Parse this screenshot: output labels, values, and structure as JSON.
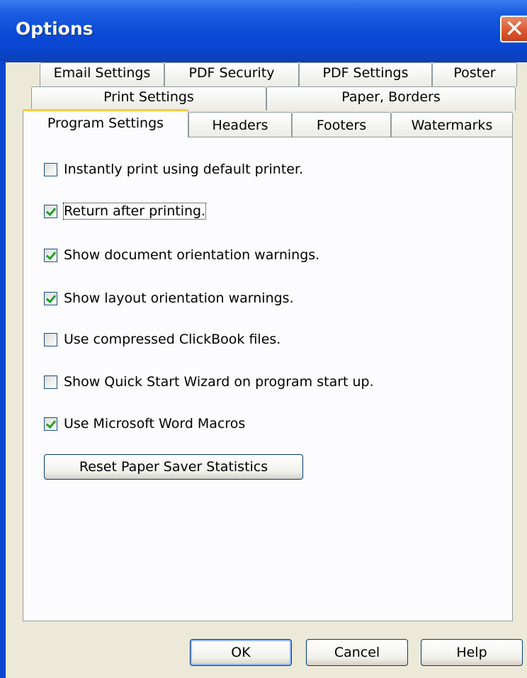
{
  "window": {
    "title": "Options"
  },
  "tabs": {
    "row1": [
      "Email Settings",
      "PDF Security",
      "PDF Settings",
      "Poster"
    ],
    "row2": [
      "Print Settings",
      "Paper, Borders"
    ],
    "row3": [
      "Program Settings",
      "Headers",
      "Footers",
      "Watermarks"
    ],
    "active": "Program Settings"
  },
  "options": [
    {
      "label": "Instantly print using default printer.",
      "checked": false
    },
    {
      "label": "Return after printing.",
      "checked": true
    },
    {
      "label": "Show document orientation warnings.",
      "checked": true
    },
    {
      "label": "Show layout orientation warnings.",
      "checked": true
    },
    {
      "label": "Use compressed ClickBook files.",
      "checked": false
    },
    {
      "label": "Show Quick Start Wizard on program start up.",
      "checked": false
    },
    {
      "label": "Use Microsoft Word Macros",
      "checked": true
    }
  ],
  "reset_button": "Reset Paper Saver Statistics",
  "footer": {
    "ok": "OK",
    "cancel": "Cancel",
    "help": "Help"
  },
  "icons": {
    "close": "close-icon",
    "check": "checkmark-icon"
  },
  "colors": {
    "titlebar": "#0a46d0",
    "active_tab_accent": "#ffc83c",
    "close_button": "#d9542c",
    "check": "#21a121"
  }
}
